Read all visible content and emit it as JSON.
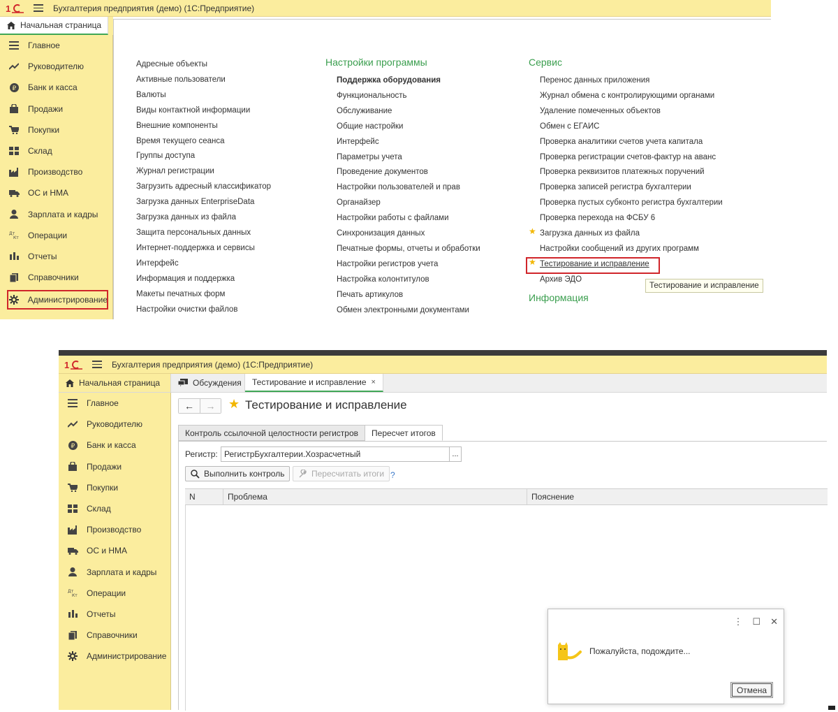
{
  "app": {
    "title": "Бухгалтерия предприятия (демо)  (1С:Предприятие)",
    "logo_text": "1С"
  },
  "colors": {
    "sidebar_bg": "#fbed9e",
    "section_heading": "#3a9e4e",
    "highlight_red": "#d0252a",
    "star": "#f2b600"
  },
  "sections": [
    {
      "label": "Главное",
      "icon": "list-icon"
    },
    {
      "label": "Руководителю",
      "icon": "trend-icon"
    },
    {
      "label": "Банк и касса",
      "icon": "ruble-coin-icon"
    },
    {
      "label": "Продажи",
      "icon": "shopping-bag-icon"
    },
    {
      "label": "Покупки",
      "icon": "cart-icon"
    },
    {
      "label": "Склад",
      "icon": "warehouse-grid-icon"
    },
    {
      "label": "Производство",
      "icon": "factory-icon"
    },
    {
      "label": "ОС и НМА",
      "icon": "truck-icon"
    },
    {
      "label": "Зарплата и кадры",
      "icon": "person-icon"
    },
    {
      "label": "Операции",
      "icon": "dt-kt-icon"
    },
    {
      "label": "Отчеты",
      "icon": "bar-chart-icon"
    },
    {
      "label": "Справочники",
      "icon": "books-icon"
    },
    {
      "label": "Администрирование",
      "icon": "gear-icon"
    }
  ],
  "top_window": {
    "home_tab": "Начальная страница",
    "col1": {
      "links": [
        "Адресные объекты",
        "Активные пользователи",
        "Валюты",
        "Виды контактной информации",
        "Внешние компоненты",
        "Время текущего сеанса",
        "Группы доступа",
        "Журнал регистрации",
        "Загрузить адресный классификатор",
        "Загрузка данных EnterpriseData",
        "Загрузка данных из файла",
        "Защита персональных данных",
        "Интернет-поддержка и сервисы",
        "Интерфейс",
        "Информация и поддержка",
        "Макеты печатных форм",
        "Настройки очистки файлов"
      ]
    },
    "col2": {
      "heading": "Настройки программы",
      "links": [
        "Поддержка оборудования",
        "Функциональность",
        "Обслуживание",
        "Общие настройки",
        "Интерфейс",
        "Параметры учета",
        "Проведение документов",
        "Настройки пользователей и прав",
        "Органайзер",
        "Настройки работы с файлами",
        "Синхронизация данных",
        "Печатные формы, отчеты и обработки",
        "Настройки регистров учета",
        "Настройка колонтитулов",
        "Печать артикулов",
        "Обмен электронными документами"
      ]
    },
    "col3": {
      "heading": "Сервис",
      "links": [
        "Перенос данных приложения",
        "Журнал обмена с контролирующими органами",
        "Удаление помеченных объектов",
        "Обмен с ЕГАИС",
        "Проверка аналитики счетов учета капитала",
        "Проверка регистрации счетов-фактур на аванс",
        "Проверка реквизитов платежных поручений",
        "Проверка записей регистра бухгалтерии",
        "Проверка пустых субконто регистра бухгалтерии",
        "Проверка перехода на ФСБУ 6",
        "Загрузка данных из файла",
        "Настройки сообщений из других программ",
        "Тестирование и исправление",
        "Архив ЭДО"
      ],
      "heading2": "Информация"
    },
    "tooltip": "Тестирование и исправление"
  },
  "bottom_window": {
    "tabs": [
      "Начальная страница",
      "Обсуждения",
      "Тестирование и исправление"
    ],
    "tab_close": "×",
    "form_title": "Тестирование и исправление",
    "form_tabs": [
      "Контроль ссылочной целостности регистров",
      "Пересчет итогов"
    ],
    "register_label": "Регистр:",
    "register_value": "РегистрБухгалтерии.Хозрасчетный",
    "register_pick": "...",
    "run_button": "Выполнить контроль",
    "recalc_button": "Пересчитать итоги",
    "help": "?",
    "grid_columns": [
      "N",
      "Проблема",
      "Пояснение"
    ],
    "wait_dialog": {
      "menu": "⋮",
      "maximize": "☐",
      "close": "✕",
      "message": "Пожалуйста, подождите...",
      "cancel": "Отмена"
    }
  }
}
